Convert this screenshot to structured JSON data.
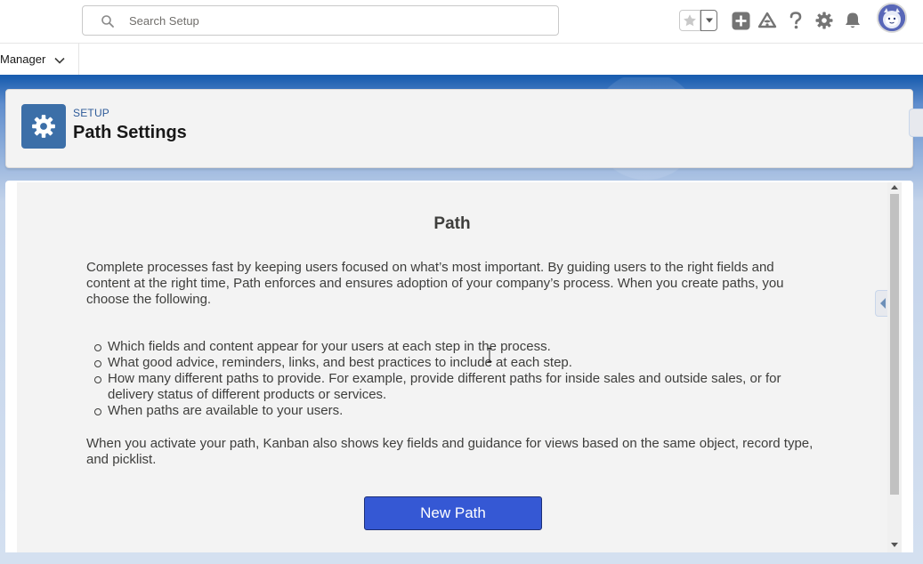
{
  "header": {
    "search_placeholder": "Search Setup",
    "icons": [
      "search-icon",
      "star-icon",
      "chevron-down-icon",
      "add-icon",
      "trailhead-icon",
      "help-icon",
      "gear-icon",
      "bell-icon",
      "avatar"
    ]
  },
  "app_nav": {
    "app_name": "Manager"
  },
  "page_header": {
    "breadcrumb": "SETUP",
    "title": "Path Settings"
  },
  "content": {
    "title": "Path",
    "intro": "Complete processes fast by keeping users focused on what’s most important. By guiding users to the right fields and content at the right time, Path enforces and ensures adoption of your company’s process. When you create paths, you choose the following.",
    "bullets": [
      "Which fields and content appear for your users at each step in the process.",
      "What good advice, reminders, links, and best practices to include at each step.",
      "How many different paths to provide. For example, provide different paths for inside sales and outside sales, or for delivery status of different products or services.",
      "When paths are available to your users."
    ],
    "outro": "When you activate your path, Kanban also shows key fields and guidance for views based on the same object, record type, and picklist.",
    "new_path_label": "New Path"
  },
  "colors": {
    "brand_blue": "#1b5eb0",
    "button_blue": "#3558d4",
    "setup_icon_bg": "#3c6fa8"
  }
}
